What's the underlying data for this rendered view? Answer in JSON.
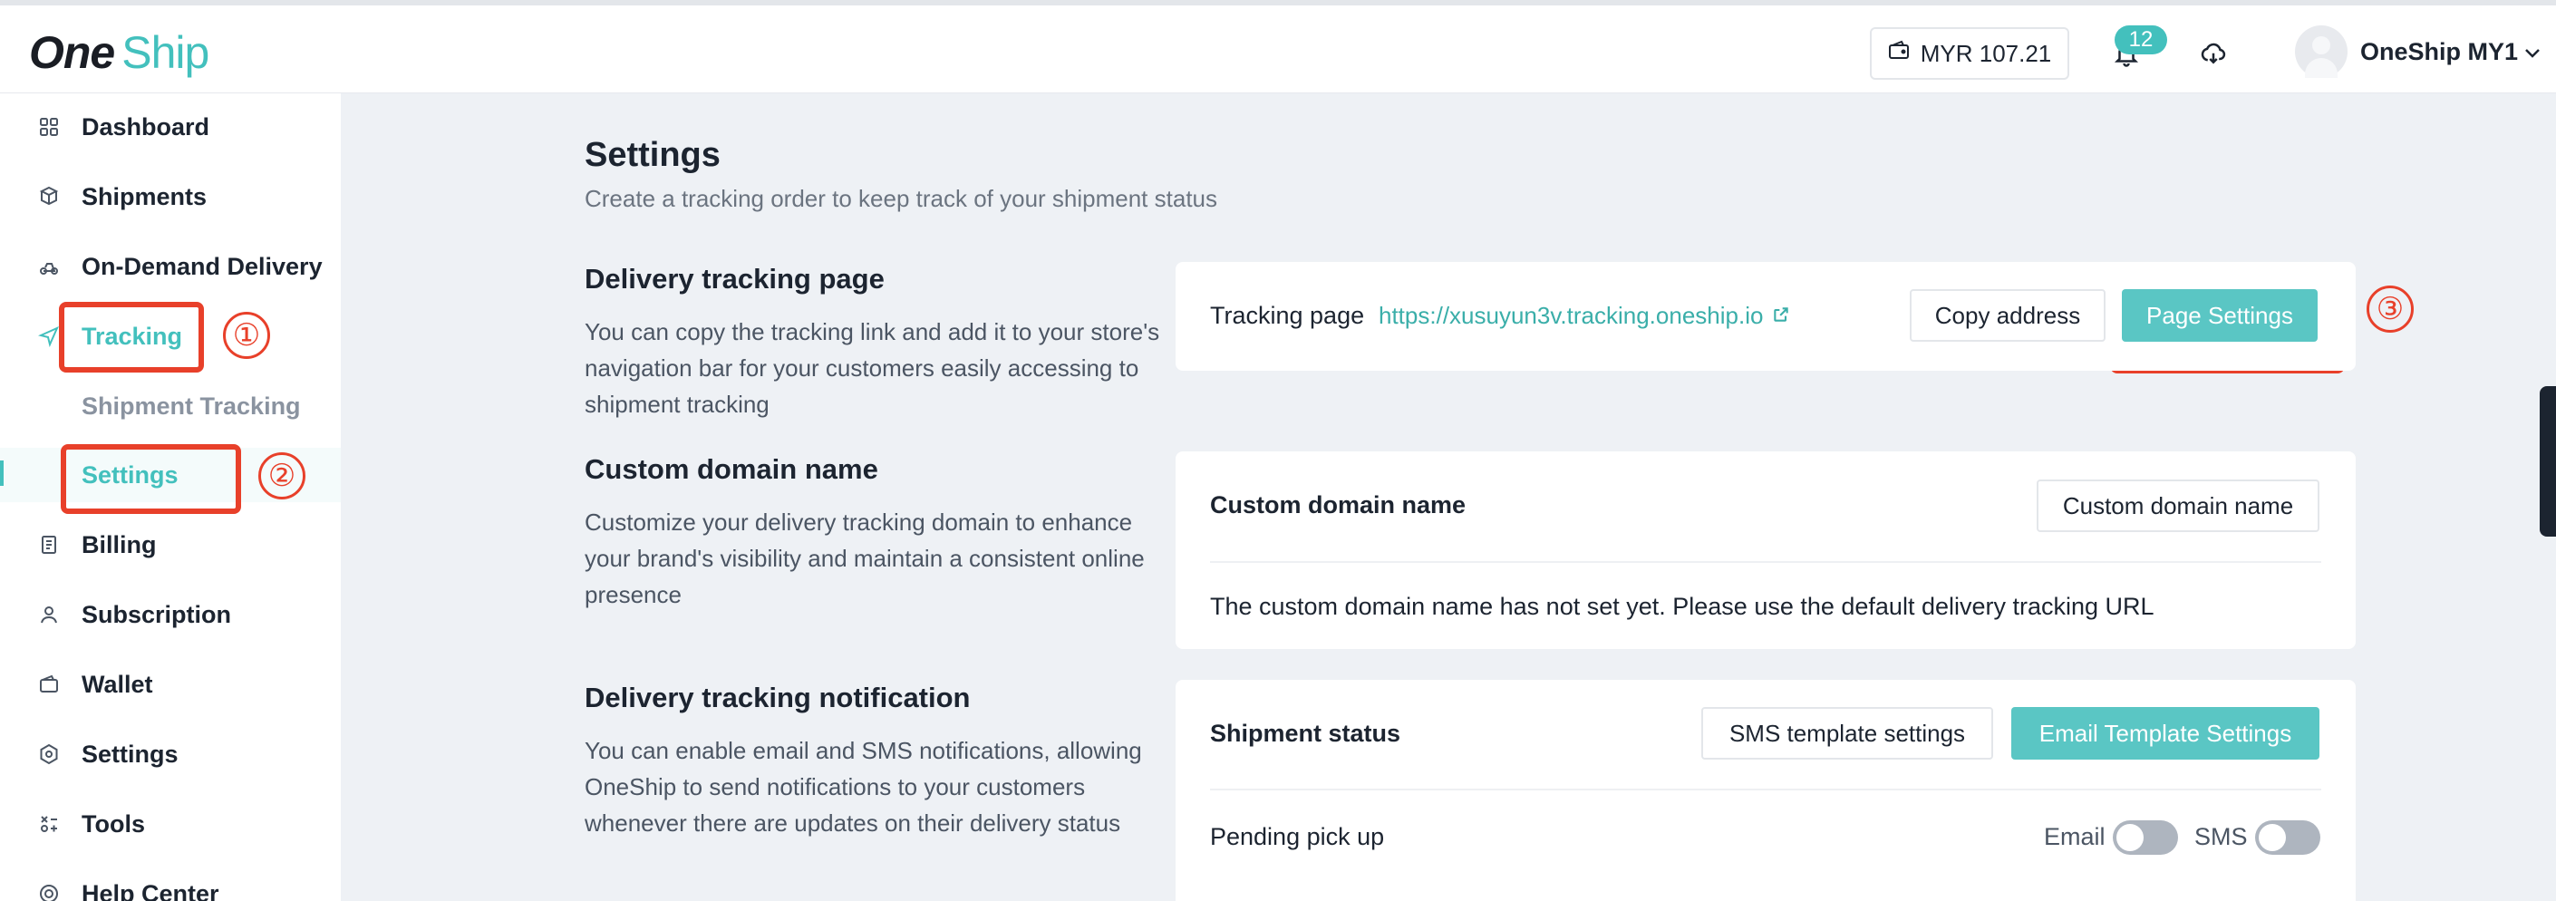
{
  "header": {
    "logo_part1": "One",
    "logo_part2": "Ship",
    "wallet_balance": "MYR 107.21",
    "notification_count": "12",
    "user_name": "OneShip MY1"
  },
  "sidebar": {
    "items": [
      {
        "label": "Dashboard",
        "icon": "dashboard-icon"
      },
      {
        "label": "Shipments",
        "icon": "shipments-icon"
      },
      {
        "label": "On-Demand Delivery",
        "icon": "on-demand-icon"
      },
      {
        "label": "Tracking",
        "icon": "tracking-icon"
      },
      {
        "label": "Shipment Tracking"
      },
      {
        "label": "Settings"
      },
      {
        "label": "Billing",
        "icon": "billing-icon"
      },
      {
        "label": "Subscription",
        "icon": "user-icon"
      },
      {
        "label": "Wallet",
        "icon": "wallet-icon"
      },
      {
        "label": "Settings",
        "icon": "gear-icon"
      },
      {
        "label": "Tools",
        "icon": "tools-icon"
      },
      {
        "label": "Help Center",
        "icon": "help-icon"
      }
    ]
  },
  "annotations": [
    "①",
    "②",
    "③"
  ],
  "colors": {
    "accent": "#43c0bd",
    "annotation": "#e8402a"
  },
  "main": {
    "title": "Settings",
    "subtitle": "Create a tracking order to keep track of your shipment status",
    "delivery_tracking_page": {
      "title": "Delivery tracking page",
      "desc": "You can copy the tracking link and add it to your store's navigation bar for your customers easily accessing to shipment tracking",
      "row_label": "Tracking page",
      "url": "https://xusuyun3v.tracking.oneship.io",
      "copy_button": "Copy address",
      "settings_button": "Page Settings"
    },
    "custom_domain": {
      "title": "Custom domain name",
      "desc": "Customize your delivery tracking domain to enhance your brand's visibility and maintain a consistent online presence",
      "row_label": "Custom domain name",
      "button": "Custom domain name",
      "note": "The custom domain name has not set yet. Please use the default delivery tracking URL"
    },
    "notification": {
      "title": "Delivery tracking notification",
      "desc": "You can enable email and SMS notifications, allowing OneShip to send notifications to your customers whenever there are updates on their delivery status",
      "row_label": "Shipment status",
      "sms_button": "SMS template settings",
      "email_button": "Email Template Settings",
      "status_row": {
        "label": "Pending pick up",
        "email_label": "Email",
        "sms_label": "SMS",
        "email_on": false,
        "sms_on": false
      }
    }
  }
}
